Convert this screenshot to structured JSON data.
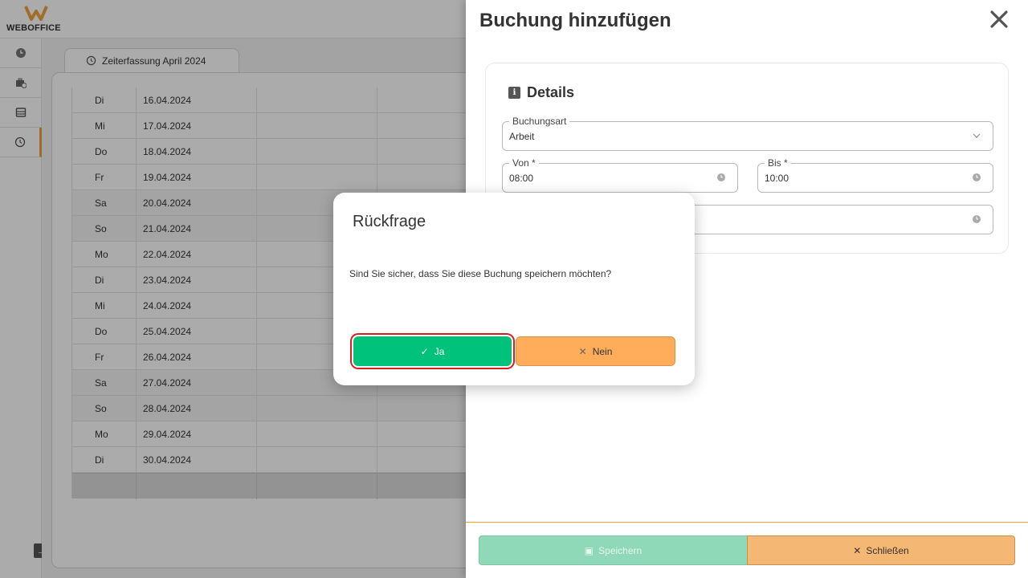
{
  "app": {
    "logo_text": "WEBOFFICE",
    "brand_color": "#f0a13c"
  },
  "tab": {
    "label": "Zeiterfassung April 2024"
  },
  "table": {
    "rows": [
      {
        "day": "Di",
        "date": "16.04.2024",
        "weekend": false
      },
      {
        "day": "Mi",
        "date": "17.04.2024",
        "weekend": false
      },
      {
        "day": "Do",
        "date": "18.04.2024",
        "weekend": false
      },
      {
        "day": "Fr",
        "date": "19.04.2024",
        "weekend": false
      },
      {
        "day": "Sa",
        "date": "20.04.2024",
        "weekend": true
      },
      {
        "day": "So",
        "date": "21.04.2024",
        "weekend": true
      },
      {
        "day": "Mo",
        "date": "22.04.2024",
        "weekend": false
      },
      {
        "day": "Di",
        "date": "23.04.2024",
        "weekend": false
      },
      {
        "day": "Mi",
        "date": "24.04.2024",
        "weekend": false
      },
      {
        "day": "Do",
        "date": "25.04.2024",
        "weekend": false
      },
      {
        "day": "Fr",
        "date": "26.04.2024",
        "weekend": false
      },
      {
        "day": "Sa",
        "date": "27.04.2024",
        "weekend": true
      },
      {
        "day": "So",
        "date": "28.04.2024",
        "weekend": true
      },
      {
        "day": "Mo",
        "date": "29.04.2024",
        "weekend": false
      },
      {
        "day": "Di",
        "date": "30.04.2024",
        "weekend": false
      }
    ]
  },
  "drawer": {
    "title": "Buchung hinzufügen",
    "details_title": "Details",
    "booking_type": {
      "label": "Buchungsart",
      "value": "Arbeit"
    },
    "from": {
      "label": "Von *",
      "value": "08:00"
    },
    "to": {
      "label": "Bis *",
      "value": "10:00"
    },
    "save_label": "Speichern",
    "close_label": "Schließen"
  },
  "dialog": {
    "title": "Rückfrage",
    "message": "Sind Sie sicher, dass Sie diese Buchung speichern möchten?",
    "yes_label": "Ja",
    "no_label": "Nein",
    "yes_color": "#00c27a",
    "no_color": "#ffad5a"
  },
  "icons": {
    "yes": "check-icon",
    "no": "x-icon",
    "close": "close-icon",
    "save": "save-icon"
  }
}
